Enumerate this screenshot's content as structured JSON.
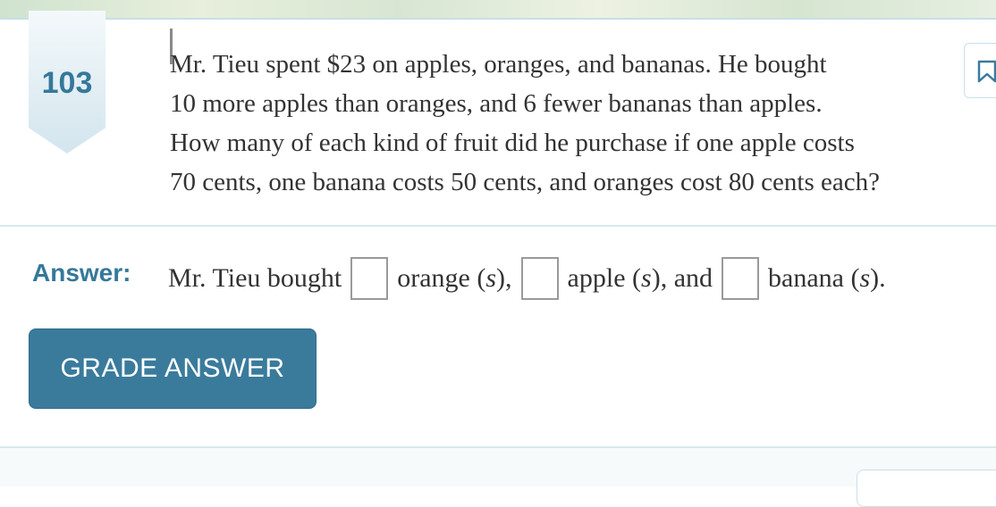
{
  "problem": {
    "number": "103",
    "question_lines": [
      "Mr. Tieu spent $23 on apples, oranges, and bananas. He bought",
      "10 more apples than oranges, and 6 fewer bananas than apples.",
      "How many of each kind of fruit did he purchase if one apple costs",
      "70 cents, one banana costs 50 cents, and oranges cost 80 cents each?"
    ]
  },
  "answer": {
    "label": "Answer:",
    "prefix": "Mr. Tieu bought",
    "orange_text": "orange (",
    "apple_text": "), ",
    "apple_word": "apple (",
    "and_text": "), and",
    "banana_word": "banana (",
    "end_text": ").",
    "s": "s",
    "orange_value": "",
    "apple_value": "",
    "banana_value": ""
  },
  "buttons": {
    "grade": "GRADE ANSWER"
  },
  "icons": {
    "bookmark": "bookmark-icon"
  },
  "colors": {
    "accent": "#3a7b9c",
    "number": "#35789a"
  }
}
